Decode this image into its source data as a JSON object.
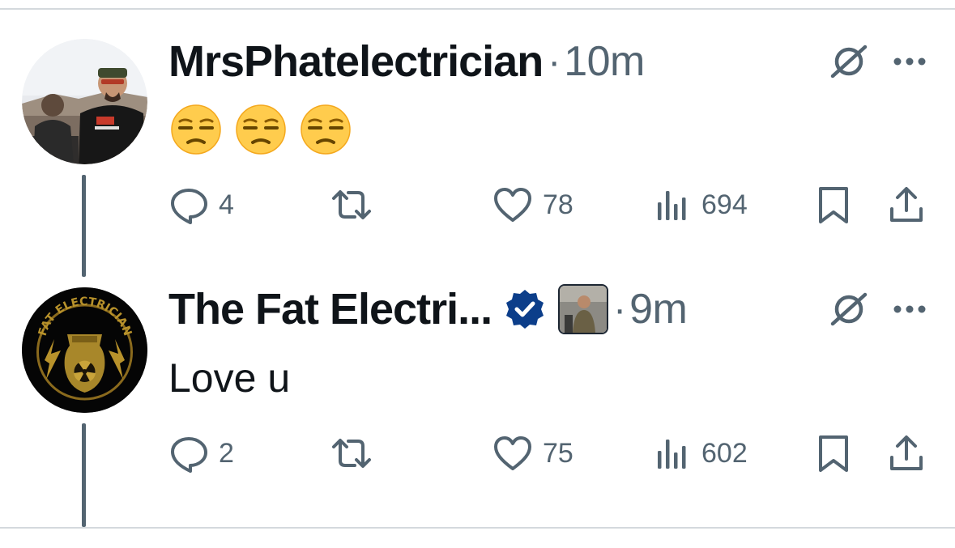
{
  "tweets": [
    {
      "name": "MrsPhatelectrician",
      "separator": "·",
      "time": "10m",
      "text": "",
      "emojis": [
        "unamused-face",
        "unamused-face",
        "unamused-face"
      ],
      "stats": {
        "replies": "4",
        "retweets": "",
        "likes": "78",
        "views": "694"
      },
      "avatar": "person-in-outdoor-photo"
    },
    {
      "name": "The Fat Electri...",
      "separator": "·",
      "time": "9m",
      "text": "Love u",
      "verified": true,
      "verified_color": "#0c3e8a",
      "affiliate_badge": "person-photo-badge",
      "stats": {
        "replies": "2",
        "retweets": "",
        "likes": "75",
        "views": "602"
      },
      "avatar": "fat-electrician-logo",
      "avatar_text": "FAT ELECTRICIAN"
    }
  ],
  "colors": {
    "text_primary": "#0f1419",
    "text_secondary": "#536471",
    "divider": "#d4d9dd",
    "logo_gold": "#b8922b"
  },
  "icons": [
    "grok-icon",
    "more-icon",
    "reply-icon",
    "retweet-icon",
    "like-icon",
    "views-icon",
    "bookmark-icon",
    "share-icon"
  ]
}
